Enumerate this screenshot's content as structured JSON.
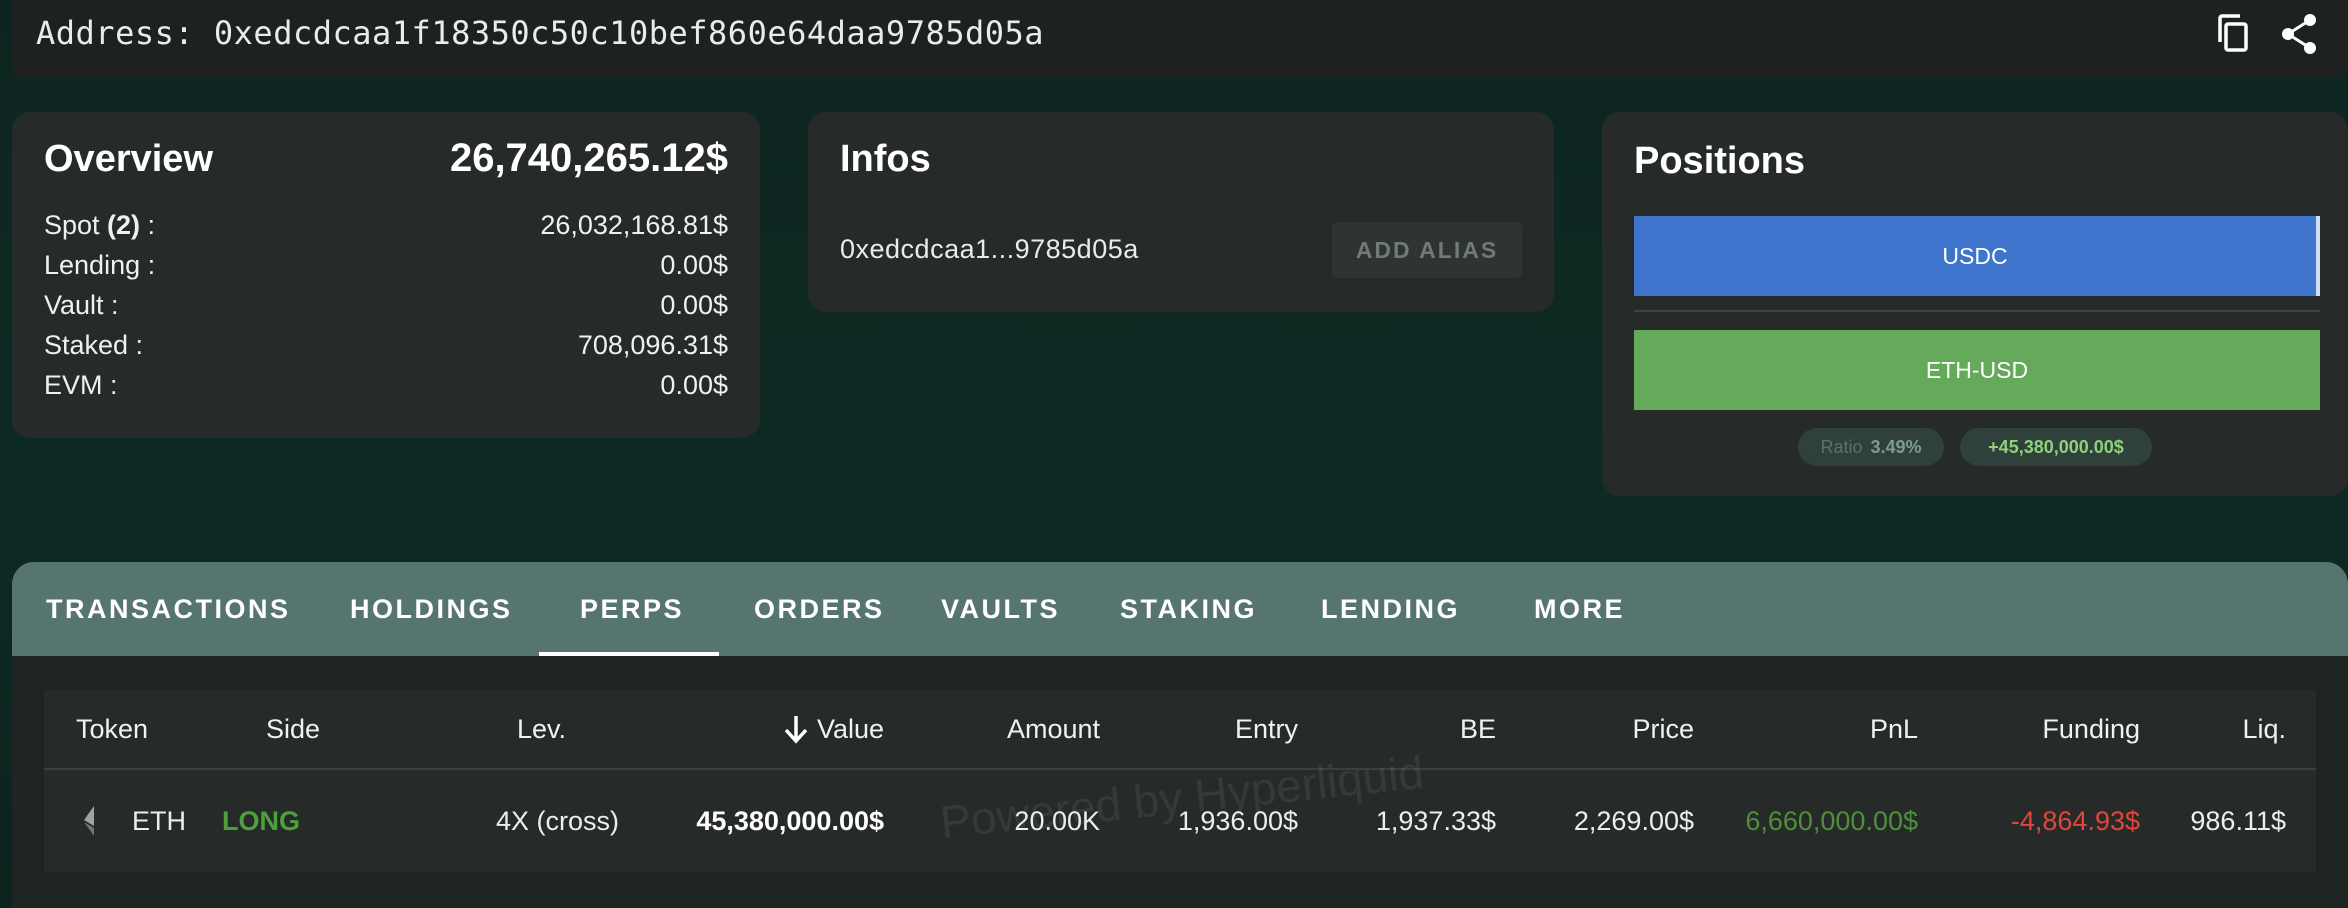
{
  "address_bar": {
    "label": "Address: 0xedcdcaa1f18350c50c10bef860e64daa9785d05a",
    "copy_icon": "copy-icon",
    "share_icon": "share-icon"
  },
  "overview": {
    "title": "Overview",
    "total": "26,740,265.12$",
    "rows": [
      {
        "label_pre": "Spot ",
        "label_bold": "(2)",
        "label_post": " :",
        "value": "26,032,168.81$"
      },
      {
        "label_pre": "Lending :",
        "label_bold": "",
        "label_post": "",
        "value": "0.00$"
      },
      {
        "label_pre": "Vault :",
        "label_bold": "",
        "label_post": "",
        "value": "0.00$"
      },
      {
        "label_pre": "Staked :",
        "label_bold": "",
        "label_post": "",
        "value": "708,096.31$"
      },
      {
        "label_pre": "EVM :",
        "label_bold": "",
        "label_post": "",
        "value": "0.00$"
      }
    ]
  },
  "infos": {
    "title": "Infos",
    "short_address": "0xedcdcaa1...9785d05a",
    "add_alias_label": "ADD ALIAS"
  },
  "positions": {
    "title": "Positions",
    "bars": [
      {
        "label": "USDC",
        "color": "#3e74cb"
      },
      {
        "label": "ETH-USD",
        "color": "#65a95b"
      }
    ],
    "ratio_label": "Ratio",
    "ratio_value": "3.49%",
    "net_value": "+45,380,000.00$"
  },
  "tabs": {
    "items": [
      "TRANSACTIONS",
      "HOLDINGS",
      "PERPS",
      "ORDERS",
      "VAULTS",
      "STAKING",
      "LENDING",
      "MORE"
    ],
    "active": "PERPS"
  },
  "table": {
    "headers": {
      "token": "Token",
      "side": "Side",
      "lev": "Lev.",
      "value": "Value",
      "amount": "Amount",
      "entry": "Entry",
      "be": "BE",
      "price": "Price",
      "pnl": "PnL",
      "funding": "Funding",
      "liq": "Liq."
    },
    "sort_icon": "arrow-down-icon",
    "rows": [
      {
        "token": "ETH",
        "side": "LONG",
        "lev": "4X (cross)",
        "value": "45,380,000.00$",
        "amount": "20.00K",
        "entry": "1,936.00$",
        "be": "1,937.33$",
        "price": "2,269.00$",
        "pnl": "6,660,000.00$",
        "funding": "-4,864.93$",
        "liq": "986.11$"
      }
    ],
    "watermark": "Powered by Hyperliquid"
  },
  "colors": {
    "long": "#4fa03c",
    "pnl": "#4f8f3c",
    "funding": "#e2453c",
    "ratio_value": "#7e9b91",
    "net_value": "#8fd17a"
  }
}
